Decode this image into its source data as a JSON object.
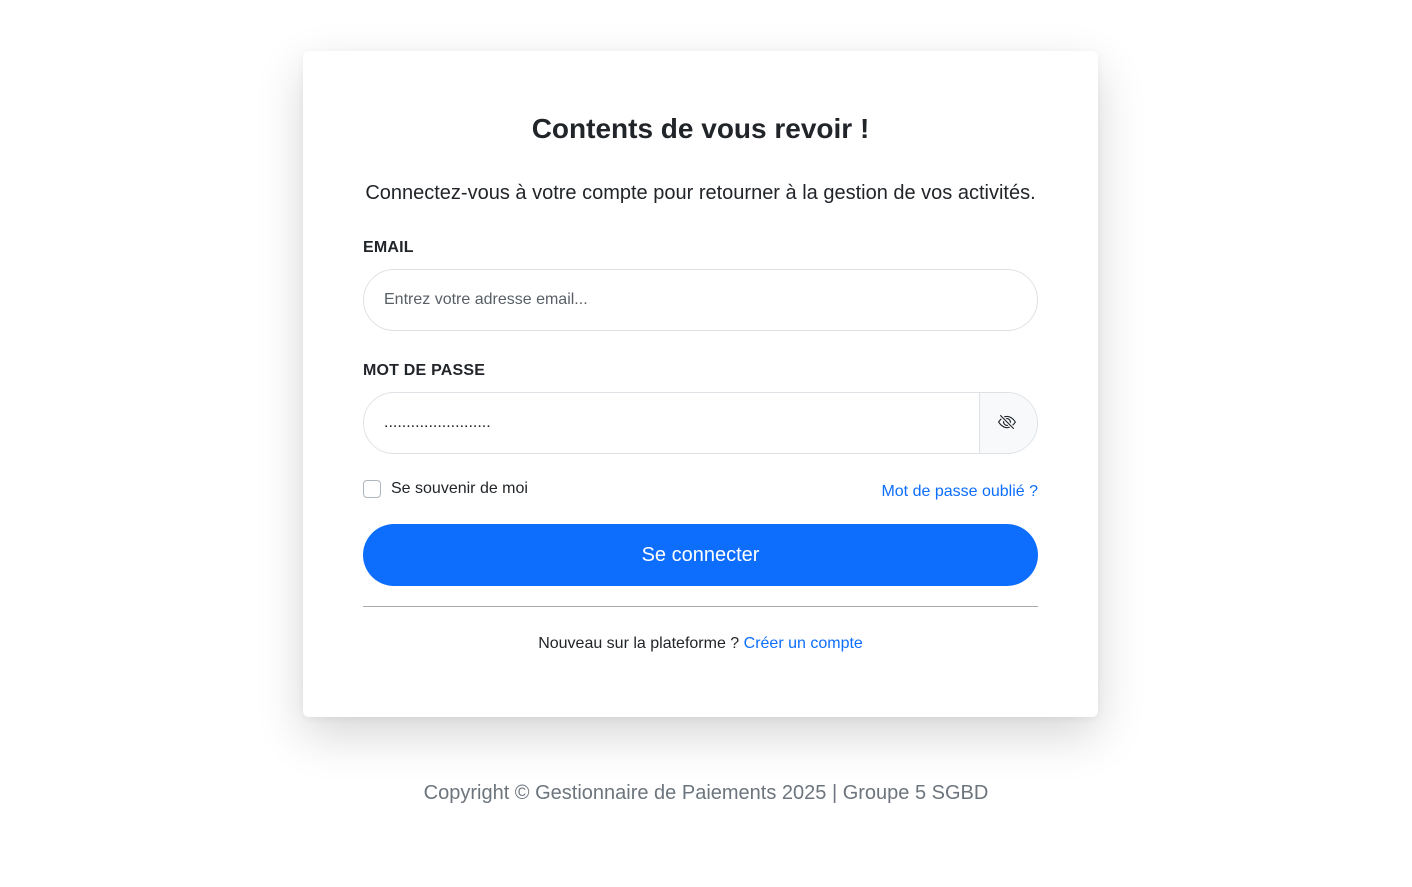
{
  "login": {
    "title": "Contents de vous revoir !",
    "subtitle": "Connectez-vous à votre compte pour retourner à la gestion de vos activités.",
    "email_label": "EMAIL",
    "email_placeholder": "Entrez votre adresse email...",
    "password_label": "MOT DE PASSE",
    "password_placeholder": "........................",
    "toggle_icon": "eye-slash-icon",
    "remember_label": "Se souvenir de moi",
    "forgot_link": "Mot de passe oublié ?",
    "submit_label": "Se connecter",
    "signup_prompt": "Nouveau sur la plateforme ?",
    "signup_link": "Créer un compte"
  },
  "footer": {
    "copyright": "Copyright © Gestionnaire de Paiements 2025 | Groupe 5 SGBD"
  },
  "colors": {
    "primary": "#0d6efd",
    "text": "#212529",
    "muted": "#6c757d",
    "border": "#dee2e6"
  }
}
